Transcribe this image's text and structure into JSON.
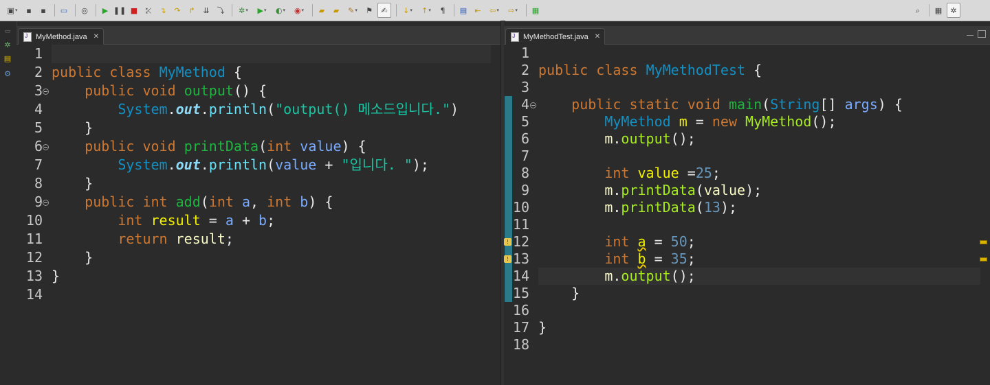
{
  "toolbar": {
    "icons": [
      "new-icon",
      "save-icon",
      "save-all-icon",
      "console-icon",
      "skip-breakpoints-icon",
      "resume-icon",
      "suspend-icon",
      "terminate-icon",
      "disconnect-icon",
      "step-into-icon",
      "step-over-icon",
      "step-return-icon",
      "drop-to-frame-icon",
      "use-step-filters-icon",
      "debug-icon",
      "run-icon",
      "coverage-icon",
      "external-tools-icon",
      "new-package-icon",
      "open-type-icon",
      "open-task-icon",
      "toggle-breadcrumb-icon",
      "mark-occurrences-icon",
      "next-annotation-icon",
      "prev-annotation-icon",
      "show-whitespace-icon",
      "pin-editor-icon",
      "last-edit-icon",
      "back-icon",
      "forward-icon",
      "new-console-icon",
      "search-icon",
      "open-perspective-icon",
      "debug-perspective-icon"
    ]
  },
  "left_editor": {
    "tab_label": "MyMethod.java",
    "line_numbers": [
      "1",
      "2",
      "3",
      "4",
      "5",
      "6",
      "7",
      "8",
      "9",
      "10",
      "11",
      "12",
      "13",
      "14"
    ],
    "fold_lines": [
      3,
      6,
      9
    ],
    "lines": [
      [],
      [
        [
          "k",
          "public"
        ],
        [
          "o",
          " "
        ],
        [
          "k",
          "class"
        ],
        [
          "o",
          " "
        ],
        [
          "t",
          "MyMethod"
        ],
        [
          "o",
          " {"
        ]
      ],
      [
        [
          "o",
          "    "
        ],
        [
          "k",
          "public"
        ],
        [
          "o",
          " "
        ],
        [
          "k",
          "void"
        ],
        [
          "o",
          " "
        ],
        [
          "m",
          "output"
        ],
        [
          "o",
          "() {"
        ]
      ],
      [
        [
          "o",
          "        "
        ],
        [
          "t",
          "System"
        ],
        [
          "o",
          "."
        ],
        [
          "sf",
          "out"
        ],
        [
          "o",
          "."
        ],
        [
          "f",
          "println"
        ],
        [
          "o",
          "("
        ],
        [
          "s",
          "\"output() 메소드입니다.\""
        ],
        [
          "o",
          ")"
        ]
      ],
      [
        [
          "o",
          "    }"
        ]
      ],
      [
        [
          "o",
          "    "
        ],
        [
          "k",
          "public"
        ],
        [
          "o",
          " "
        ],
        [
          "k",
          "void"
        ],
        [
          "o",
          " "
        ],
        [
          "m",
          "printData"
        ],
        [
          "o",
          "("
        ],
        [
          "k",
          "int"
        ],
        [
          "o",
          " "
        ],
        [
          "p",
          "value"
        ],
        [
          "o",
          ") {"
        ]
      ],
      [
        [
          "o",
          "        "
        ],
        [
          "t",
          "System"
        ],
        [
          "o",
          "."
        ],
        [
          "sf",
          "out"
        ],
        [
          "o",
          "."
        ],
        [
          "f",
          "println"
        ],
        [
          "o",
          "("
        ],
        [
          "p",
          "value"
        ],
        [
          "o",
          " + "
        ],
        [
          "s",
          "\"입니다. \""
        ],
        [
          "o",
          ");"
        ]
      ],
      [
        [
          "o",
          "    }"
        ]
      ],
      [
        [
          "o",
          "    "
        ],
        [
          "k",
          "public"
        ],
        [
          "o",
          " "
        ],
        [
          "k",
          "int"
        ],
        [
          "o",
          " "
        ],
        [
          "m",
          "add"
        ],
        [
          "o",
          "("
        ],
        [
          "k",
          "int"
        ],
        [
          "o",
          " "
        ],
        [
          "p",
          "a"
        ],
        [
          "o",
          ", "
        ],
        [
          "k",
          "int"
        ],
        [
          "o",
          " "
        ],
        [
          "p",
          "b"
        ],
        [
          "o",
          ") {"
        ]
      ],
      [
        [
          "o",
          "        "
        ],
        [
          "k",
          "int"
        ],
        [
          "o",
          " "
        ],
        [
          "lv",
          "result"
        ],
        [
          "o",
          " = "
        ],
        [
          "p",
          "a"
        ],
        [
          "o",
          " + "
        ],
        [
          "p",
          "b"
        ],
        [
          "o",
          ";"
        ]
      ],
      [
        [
          "o",
          "        "
        ],
        [
          "k",
          "return"
        ],
        [
          "o",
          " "
        ],
        [
          "r",
          "result"
        ],
        [
          "o",
          ";"
        ]
      ],
      [
        [
          "o",
          "    }"
        ]
      ],
      [
        [
          "o",
          "}"
        ]
      ],
      []
    ]
  },
  "right_editor": {
    "tab_label": "MyMethodTest.java",
    "line_numbers": [
      "1",
      "2",
      "3",
      "4",
      "5",
      "6",
      "7",
      "8",
      "9",
      "10",
      "11",
      "12",
      "13",
      "14",
      "15",
      "16",
      "17",
      "18"
    ],
    "fold_lines": [
      4
    ],
    "warning_lines": [
      12,
      13
    ],
    "lines": [
      [],
      [
        [
          "k",
          "public"
        ],
        [
          "o",
          " "
        ],
        [
          "k",
          "class"
        ],
        [
          "o",
          " "
        ],
        [
          "t",
          "MyMethodTest"
        ],
        [
          "o",
          " {"
        ]
      ],
      [],
      [
        [
          "o",
          "    "
        ],
        [
          "k",
          "public"
        ],
        [
          "o",
          " "
        ],
        [
          "k",
          "static"
        ],
        [
          "o",
          " "
        ],
        [
          "k",
          "void"
        ],
        [
          "o",
          " "
        ],
        [
          "m",
          "main"
        ],
        [
          "o",
          "("
        ],
        [
          "t",
          "String"
        ],
        [
          "o",
          "[] "
        ],
        [
          "p",
          "args"
        ],
        [
          "o",
          ") {"
        ]
      ],
      [
        [
          "o",
          "        "
        ],
        [
          "t",
          "MyMethod"
        ],
        [
          "o",
          " "
        ],
        [
          "lv",
          "m"
        ],
        [
          "o",
          " = "
        ],
        [
          "k",
          "new"
        ],
        [
          "o",
          " "
        ],
        [
          "mc",
          "MyMethod"
        ],
        [
          "o",
          "();"
        ]
      ],
      [
        [
          "o",
          "        "
        ],
        [
          "r",
          "m"
        ],
        [
          "o",
          "."
        ],
        [
          "mc",
          "output"
        ],
        [
          "o",
          "();"
        ]
      ],
      [],
      [
        [
          "o",
          "        "
        ],
        [
          "k",
          "int"
        ],
        [
          "o",
          " "
        ],
        [
          "lv",
          "value"
        ],
        [
          "o",
          " ="
        ],
        [
          "n",
          "25"
        ],
        [
          "o",
          ";"
        ]
      ],
      [
        [
          "o",
          "        "
        ],
        [
          "r",
          "m"
        ],
        [
          "o",
          "."
        ],
        [
          "mc",
          "printData"
        ],
        [
          "o",
          "("
        ],
        [
          "r",
          "value"
        ],
        [
          "o",
          ");"
        ]
      ],
      [
        [
          "o",
          "        "
        ],
        [
          "r",
          "m"
        ],
        [
          "o",
          "."
        ],
        [
          "mc",
          "printData"
        ],
        [
          "o",
          "("
        ],
        [
          "n",
          "13"
        ],
        [
          "o",
          ");"
        ]
      ],
      [],
      [
        [
          "o",
          "        "
        ],
        [
          "k",
          "int"
        ],
        [
          "o",
          " "
        ],
        [
          "lvw",
          "a"
        ],
        [
          "o",
          " = "
        ],
        [
          "n",
          "50"
        ],
        [
          "o",
          ";"
        ]
      ],
      [
        [
          "o",
          "        "
        ],
        [
          "k",
          "int"
        ],
        [
          "o",
          " "
        ],
        [
          "lvw",
          "b"
        ],
        [
          "o",
          " = "
        ],
        [
          "n",
          "35"
        ],
        [
          "o",
          ";"
        ]
      ],
      [
        [
          "o",
          "        "
        ],
        [
          "r",
          "m"
        ],
        [
          "o",
          "."
        ],
        [
          "mc",
          "output"
        ],
        [
          "o",
          "();"
        ]
      ],
      [
        [
          "o",
          "    }"
        ]
      ],
      [],
      [
        [
          "o",
          "}"
        ]
      ],
      []
    ]
  }
}
